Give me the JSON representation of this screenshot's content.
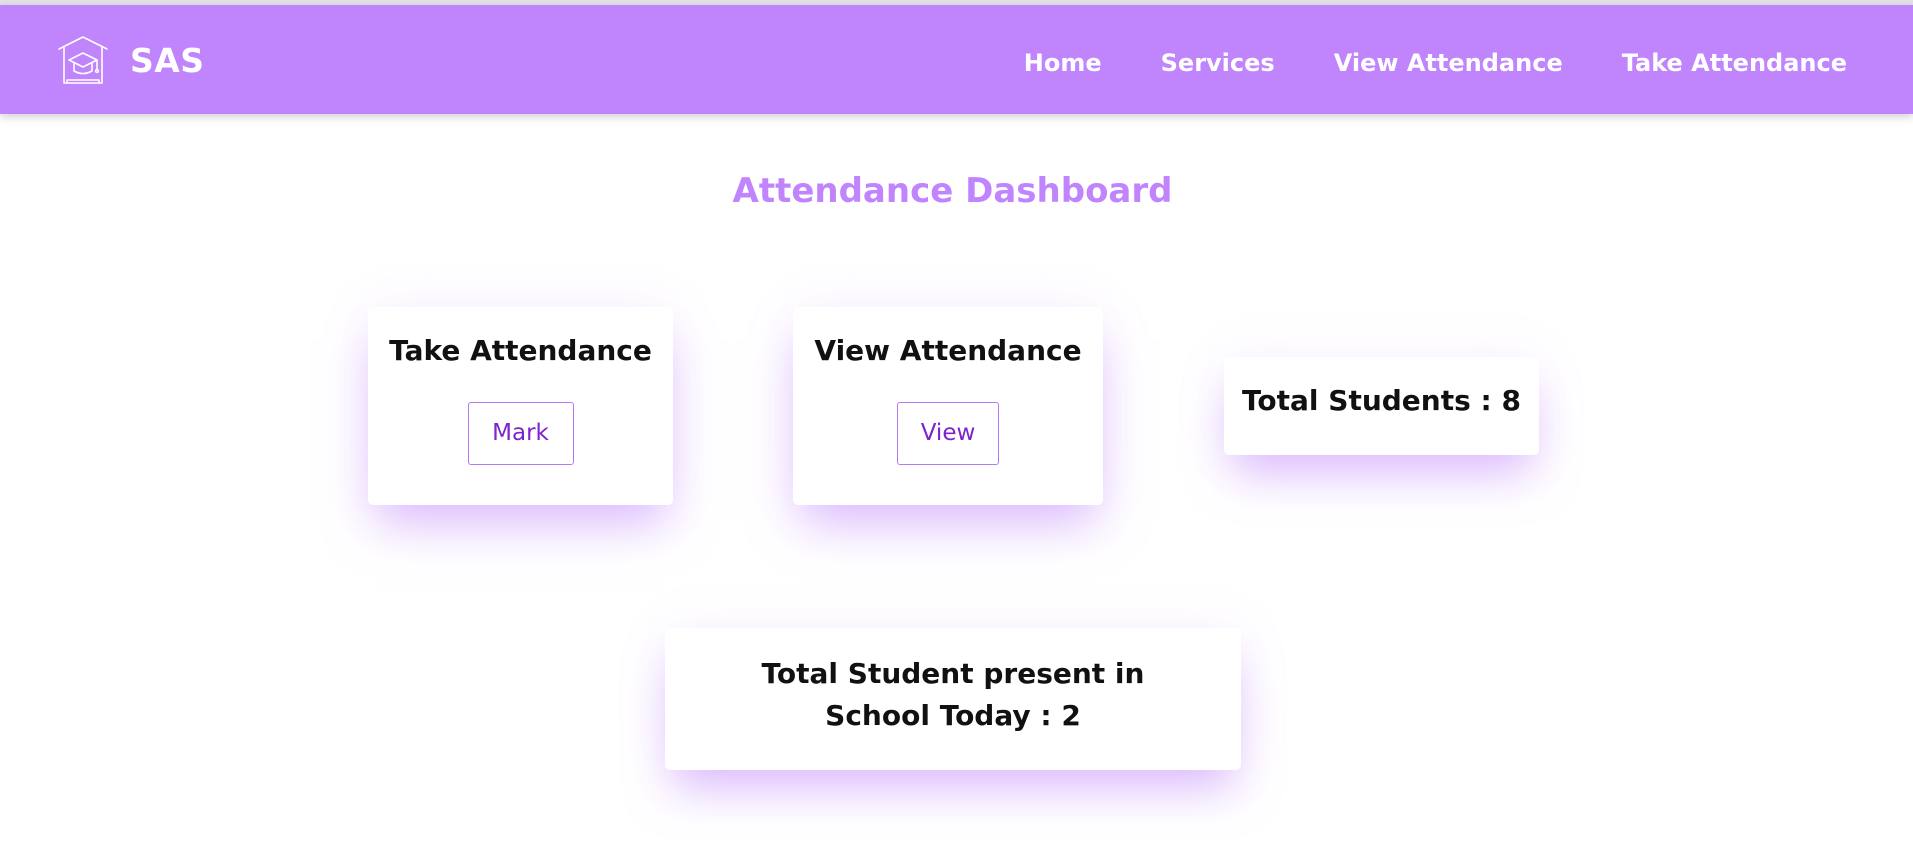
{
  "navbar": {
    "brand": "SAS",
    "logo_icon": "school-cap-logo-icon",
    "background": "#c084fc",
    "links": [
      "Home",
      "Services",
      "View Attendance",
      "Take Attendance"
    ]
  },
  "dashboard": {
    "title": "Attendance Dashboard",
    "accent": "#c084fc",
    "take_card": {
      "title": "Take Attendance",
      "button": "Mark"
    },
    "view_card": {
      "title": "View Attendance",
      "button": "View"
    },
    "total_students": "Total Students : 8",
    "present_today": "Total Student present in School Today : 2"
  }
}
